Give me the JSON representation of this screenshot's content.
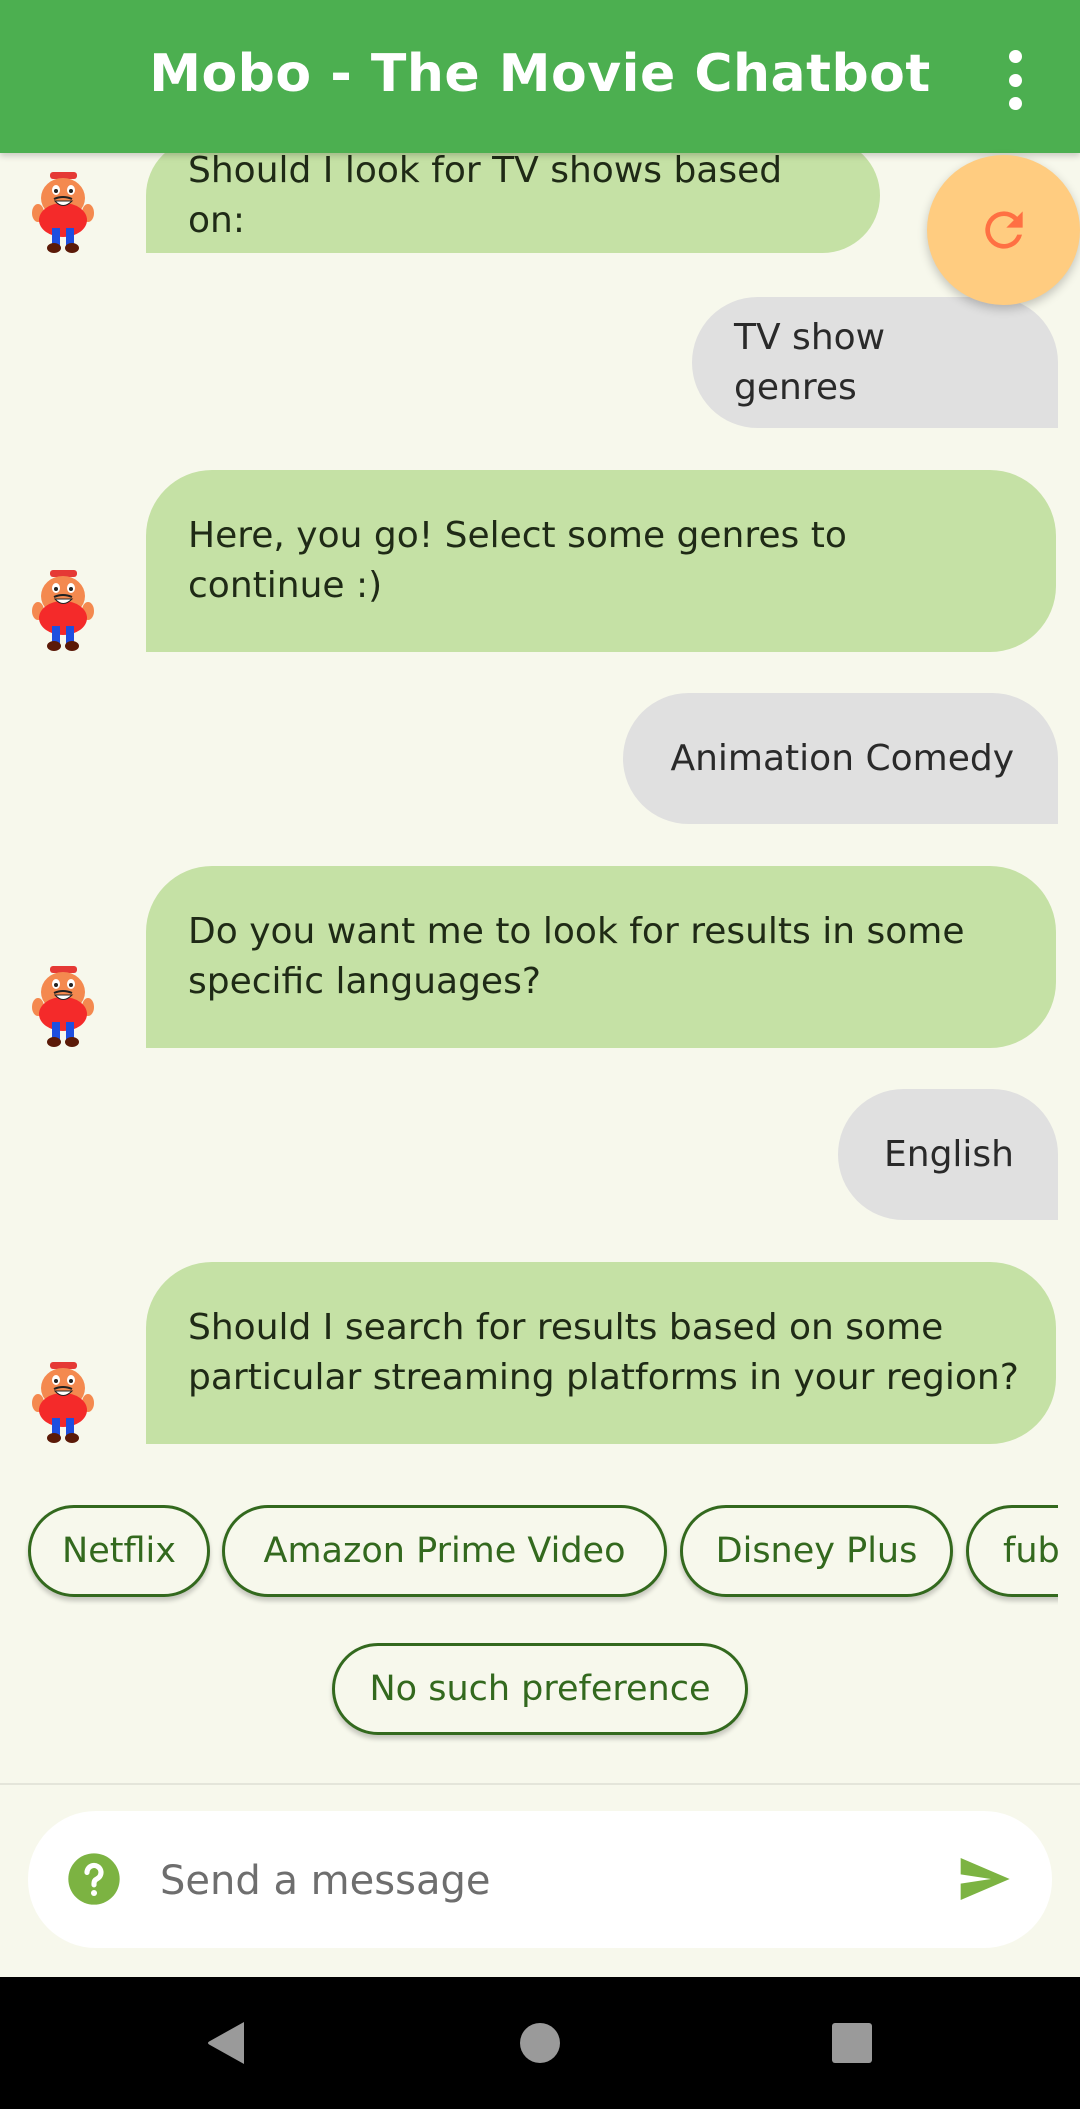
{
  "header": {
    "title": "Mobo - The Movie Chatbot",
    "menu_icon": "more-vert-icon"
  },
  "fab": {
    "icon": "refresh-icon",
    "color": "#FFCC80",
    "icon_color": "#FF7043"
  },
  "colors": {
    "header": "#4CAF50",
    "background": "#F7F8EC",
    "bot_bubble": "#C5E1A5",
    "user_bubble": "#E0E0E0",
    "chip_border": "#33691E",
    "accent": "#7CB342"
  },
  "messages": [
    {
      "sender": "bot",
      "text": "Should I look for TV shows based on:"
    },
    {
      "sender": "user",
      "text": "TV show genres"
    },
    {
      "sender": "bot",
      "text": "Here, you go! Select some genres to continue :)"
    },
    {
      "sender": "user",
      "text": "Animation Comedy"
    },
    {
      "sender": "bot",
      "text": "Do you want me to look for results in some specific languages?"
    },
    {
      "sender": "user",
      "text": "English"
    },
    {
      "sender": "bot",
      "text": "Should I search for results based on some particular streaming platforms in your region?"
    }
  ],
  "suggestions": [
    "Netflix",
    "Amazon Prime Video",
    "Disney Plus",
    "fub"
  ],
  "suggestion_extra": "No such preference",
  "composer": {
    "placeholder": "Send a message",
    "value": "",
    "help_icon": "help-circle-icon",
    "send_icon": "send-icon"
  },
  "navbar": {
    "back": "back-icon",
    "home": "home-icon",
    "recents": "recents-icon"
  }
}
